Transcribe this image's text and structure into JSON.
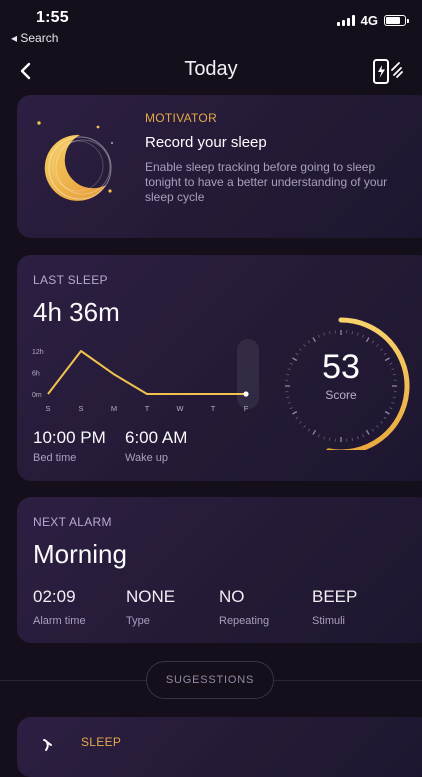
{
  "status_bar": {
    "time": "1:55",
    "back_label": "◂ Search",
    "network": "4G"
  },
  "header": {
    "title": "Today"
  },
  "motivator": {
    "kicker": "MOTIVATOR",
    "title": "Record your sleep",
    "body_lines": [
      "Enable sleep tracking before going to sleep",
      "tonight to have a better understanding of your",
      "sleep cycle"
    ]
  },
  "last_sleep": {
    "kicker": "LAST SLEEP",
    "duration": "4h 36m",
    "bed_time": "10:00 PM",
    "bed_time_label": "Bed time",
    "wake_up": "6:00 AM",
    "wake_up_label": "Wake up",
    "score": "53",
    "score_label": "Score",
    "score_fraction": 0.53
  },
  "chart_data": {
    "type": "line",
    "categories": [
      "S",
      "S",
      "M",
      "T",
      "W",
      "T",
      "F"
    ],
    "y_ticks": [
      "12h",
      "6h",
      "0m"
    ],
    "values": [
      0,
      12,
      5.5,
      0,
      0,
      0,
      0
    ],
    "ylim": [
      0,
      12
    ]
  },
  "next_alarm": {
    "kicker": "NEXT ALARM",
    "name": "Morning",
    "fields": [
      {
        "value": "02:09",
        "label": "Alarm time"
      },
      {
        "value": "NONE",
        "label": "Type"
      },
      {
        "value": "NO",
        "label": "Repeating"
      },
      {
        "value": "BEEP",
        "label": "Stimuli"
      }
    ]
  },
  "suggestions": {
    "label": "SUGESSTIONS"
  },
  "sleep_card": {
    "kicker": "SLEEP"
  },
  "colors": {
    "accent": "#e4a94a",
    "chart_line": "#f2c24e",
    "background": "#140f1b"
  }
}
